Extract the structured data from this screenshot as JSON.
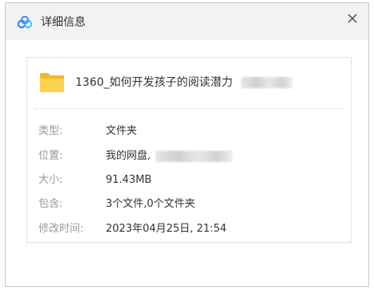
{
  "window": {
    "title": "详细信息",
    "close_glyph": "✕"
  },
  "file": {
    "name": "1360_如何开发孩子的阅读潜力",
    "icon": "folder-icon",
    "icon_color": "#f7c948"
  },
  "details": {
    "type_label": "类型:",
    "type_value": "文件夹",
    "location_label": "位置:",
    "location_value": "我的网盘,",
    "size_label": "大小:",
    "size_value": "91.43MB",
    "contains_label": "包含:",
    "contains_value": "3个文件,0个文件夹",
    "modified_label": "修改时间:",
    "modified_value": "2023年04月25日, 21:54"
  },
  "colors": {
    "label": "#999999",
    "value": "#333333",
    "titlebar": "#f2f2f3",
    "logo_blue": "#2b7cf6"
  }
}
